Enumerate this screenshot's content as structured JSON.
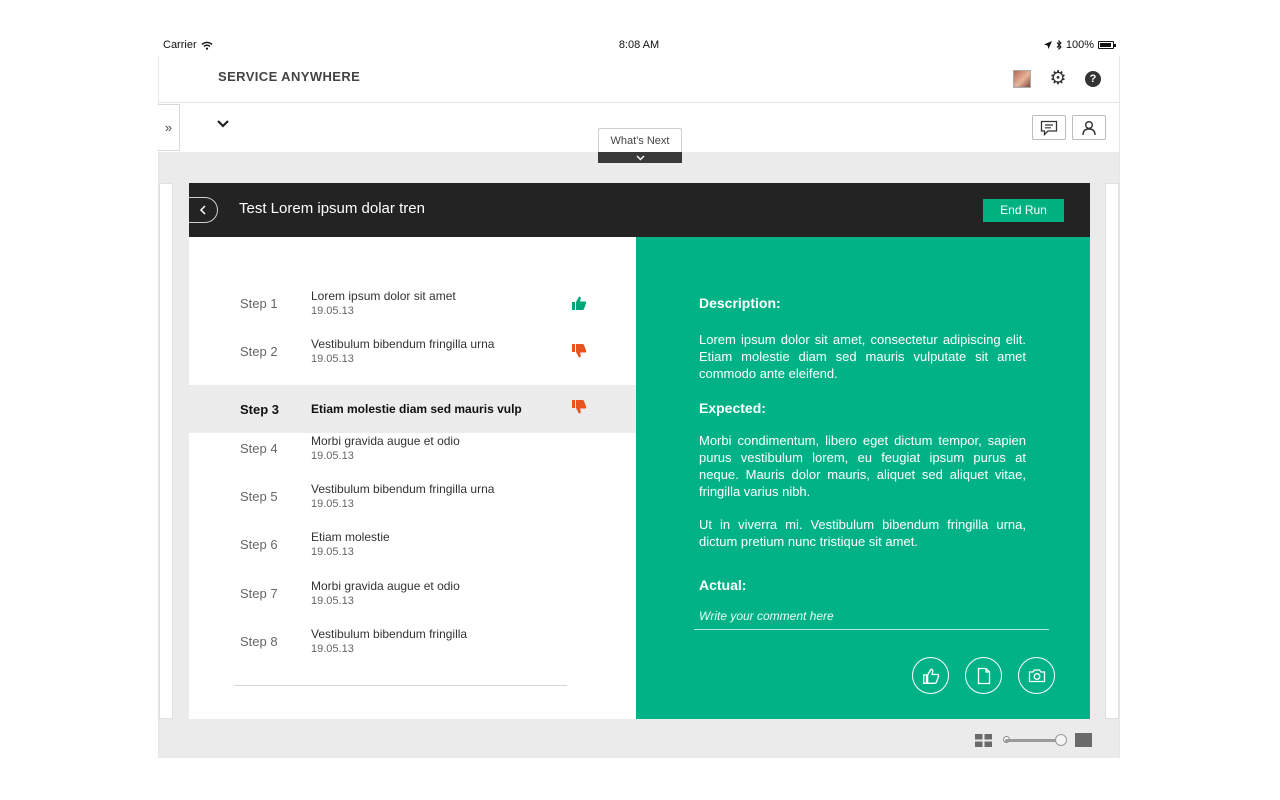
{
  "status_bar": {
    "carrier": "Carrier",
    "time": "8:08 AM",
    "battery": "100%"
  },
  "app": {
    "title": "SERVICE ANYWHERE"
  },
  "whats_next": {
    "label": "What's Next"
  },
  "run": {
    "title": "Test Lorem ipsum dolar tren",
    "end_button": "End Run"
  },
  "steps": [
    {
      "label": "Step 1",
      "title": "Lorem ipsum dolor sit amet",
      "date": "19.05.13",
      "result": "pass"
    },
    {
      "label": "Step 2",
      "title": "Vestibulum bibendum fringilla urna",
      "date": "19.05.13",
      "result": "fail"
    },
    {
      "label": "Step 3",
      "title": "Etiam molestie diam sed mauris vulp",
      "date": "",
      "result": "fail",
      "active": true
    },
    {
      "label": "Step 4",
      "title": "Morbi gravida augue et odio",
      "date": "19.05.13",
      "result": ""
    },
    {
      "label": "Step 5",
      "title": "Vestibulum bibendum fringilla urna",
      "date": "19.05.13",
      "result": ""
    },
    {
      "label": "Step 6",
      "title": "Etiam molestie",
      "date": "19.05.13",
      "result": ""
    },
    {
      "label": "Step 7",
      "title": "Morbi gravida augue et odio",
      "date": "19.05.13",
      "result": ""
    },
    {
      "label": "Step 8",
      "title": "Vestibulum bibendum fringilla",
      "date": "19.05.13",
      "result": ""
    }
  ],
  "detail": {
    "description_title": "Description:",
    "description_text": "Lorem ipsum dolor sit amet, consectetur adipiscing elit. Etiam molestie diam sed mauris vulputate sit amet commodo ante eleifend.",
    "expected_title": "Expected:",
    "expected_text_1": "Morbi condimentum, libero eget dictum tempor, sapien purus vestibulum lorem, eu feugiat ipsum purus at neque. Mauris dolor mauris, aliquet sed aliquet vitae, fringilla varius nibh.",
    "expected_text_2": "Ut in viverra mi. Vestibulum bibendum fringilla urna, dictum pretium nunc tristique sit amet.",
    "actual_title": "Actual:",
    "comment_placeholder": "Write your comment here"
  },
  "colors": {
    "accent": "#01b287",
    "pass": "#01a77a",
    "fail": "#e8531f",
    "header": "#232323"
  },
  "zoom": {
    "level": 1.0
  }
}
